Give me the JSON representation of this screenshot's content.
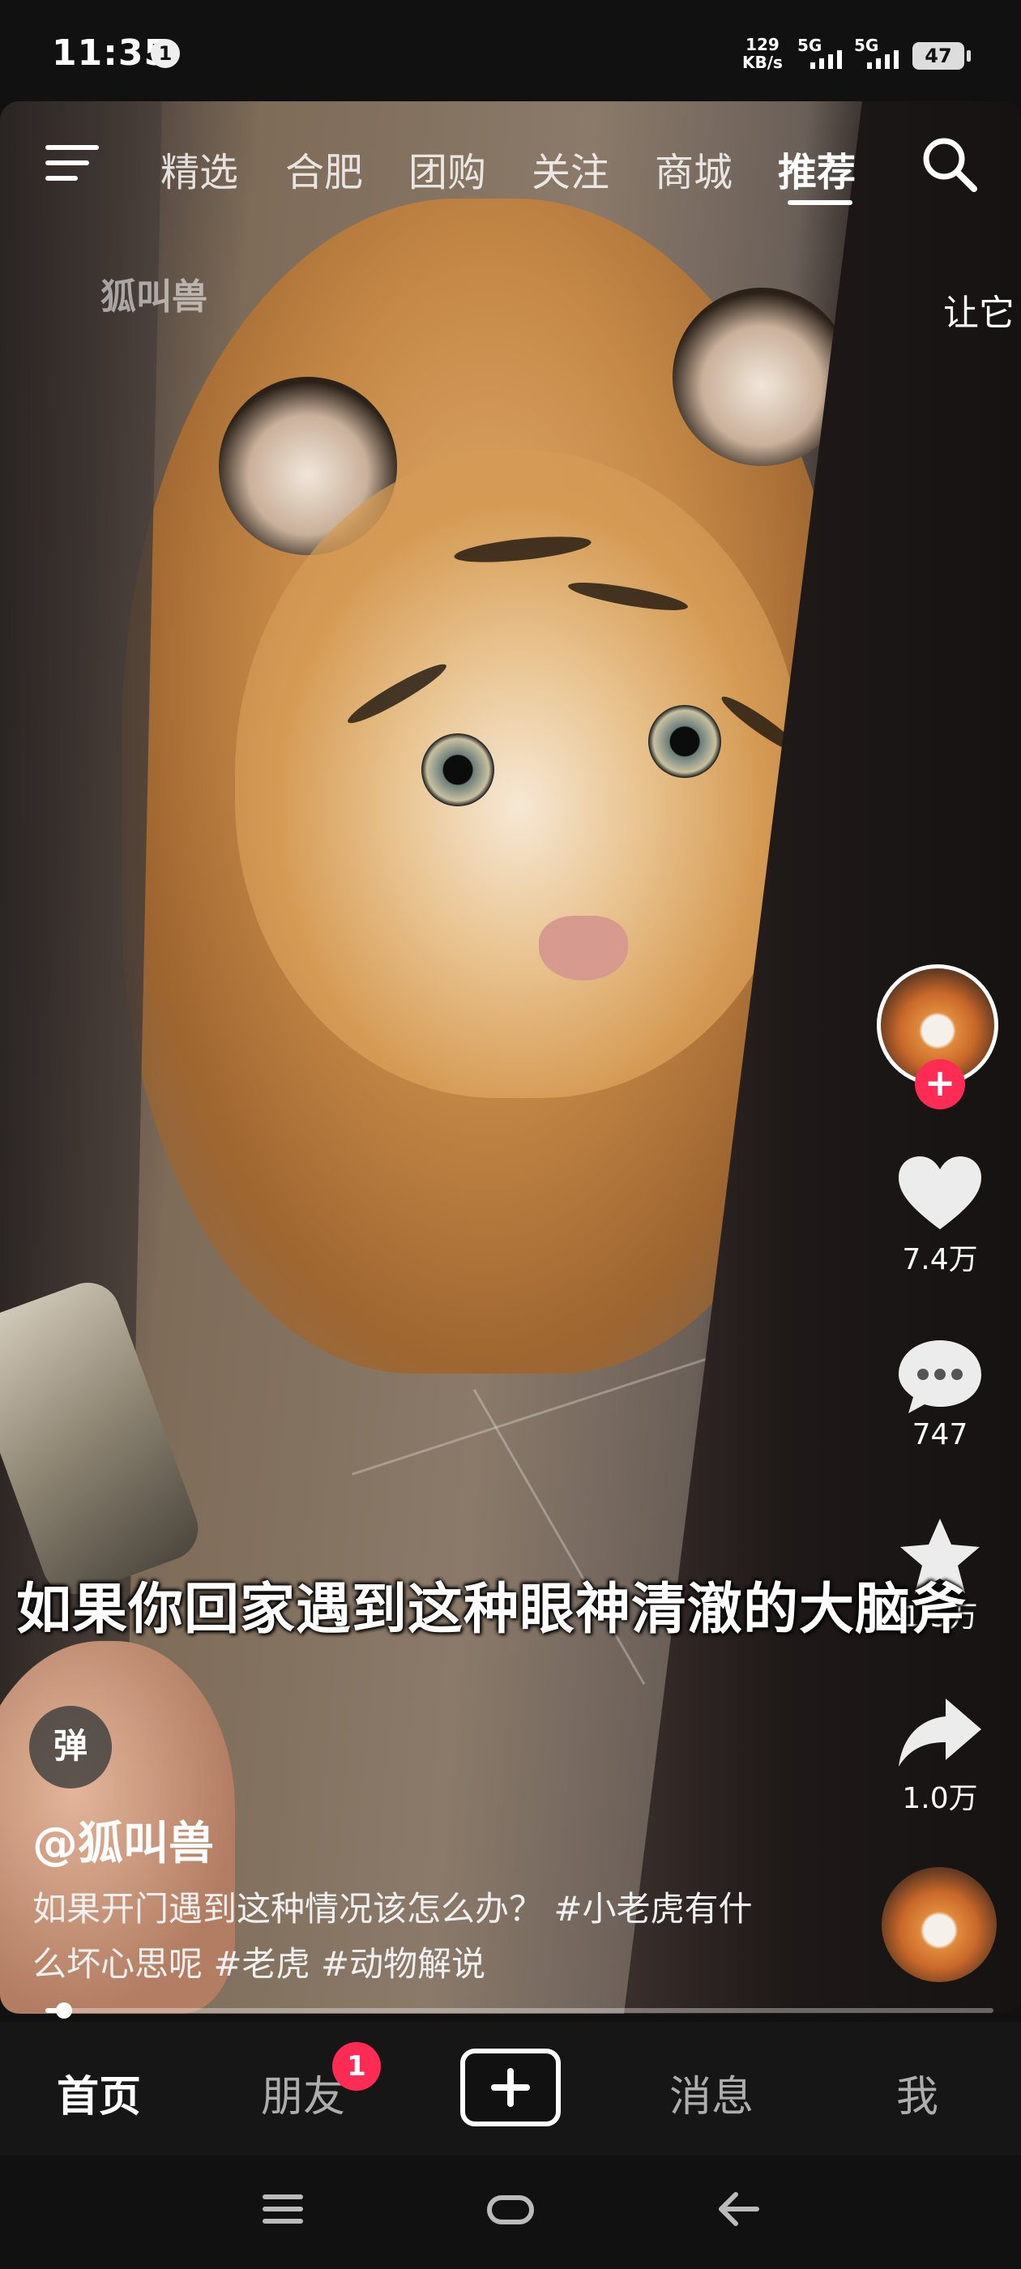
{
  "status_bar": {
    "time": "11:35",
    "notification_badge": "1",
    "net_speed_value": "129",
    "net_speed_unit": "KB/s",
    "signal1": "5G",
    "signal2": "5G",
    "battery": "47"
  },
  "video": {
    "watermark": "狐叫兽",
    "subtitle": "如果你回家遇到这种眼神清澈的大脑斧",
    "progress_fraction": 0.02
  },
  "top_nav": {
    "tabs": [
      {
        "label": "精选"
      },
      {
        "label": "合肥"
      },
      {
        "label": "团购"
      },
      {
        "label": "关注"
      },
      {
        "label": "商城"
      },
      {
        "label": "推荐"
      }
    ],
    "active_tab": "推荐"
  },
  "side_text": "让它",
  "actions": {
    "likes": "7.4万",
    "comments": "747",
    "favorites": "1.5万",
    "shares": "1.0万"
  },
  "post": {
    "danmu_label": "弹",
    "author": "@狐叫兽",
    "caption": "如果开门遇到这种情况该怎么办？ #小老虎有什么坏心思呢 #老虎 #动物解说"
  },
  "bottom_nav": {
    "home": "首页",
    "friends": "朋友",
    "friends_badge": "1",
    "messages": "消息",
    "me": "我"
  },
  "icons": {
    "menu": "menu-icon",
    "search": "search-icon",
    "like": "heart-icon",
    "comment": "comment-icon",
    "favorite": "star-icon",
    "share": "share-icon",
    "create": "plus-icon"
  },
  "colors": {
    "accent": "#fe2c55",
    "background": "#111111"
  }
}
